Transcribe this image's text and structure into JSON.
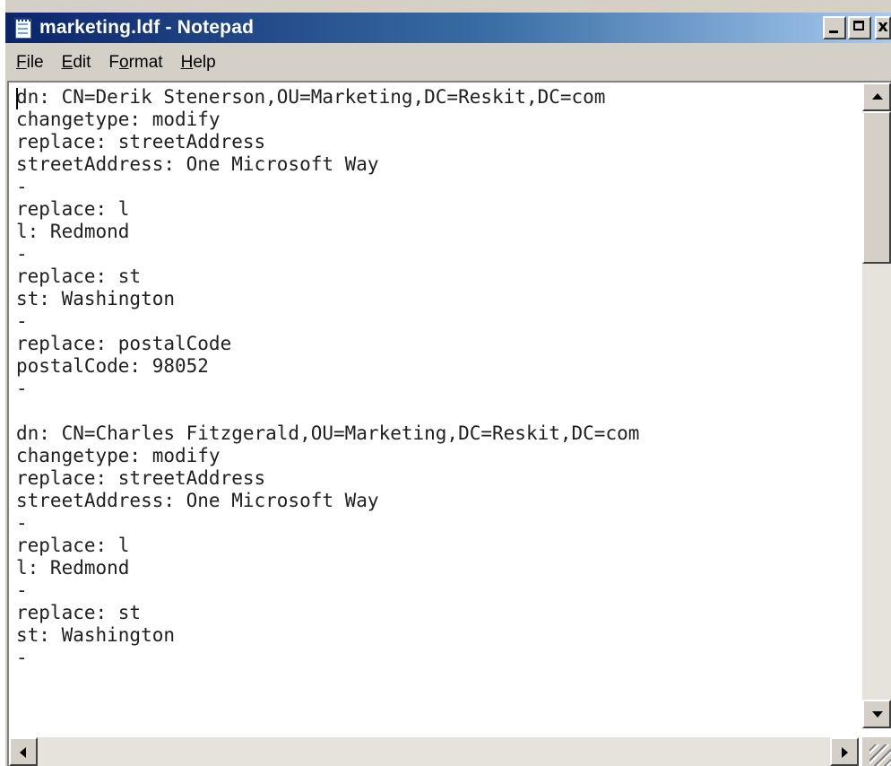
{
  "window": {
    "title": "marketing.ldf - Notepad",
    "icon": "notepad-icon",
    "close_glyph": "x"
  },
  "menu": {
    "items": [
      {
        "label": "File",
        "accel": "F",
        "rest": "ile"
      },
      {
        "label": "Edit",
        "accel": "E",
        "rest": "dit"
      },
      {
        "label": "Format",
        "pre": "F",
        "accel": "o",
        "rest": "rmat"
      },
      {
        "label": "Help",
        "accel": "H",
        "rest": "elp"
      }
    ]
  },
  "document": {
    "lines": [
      "dn: CN=Derik Stenerson,OU=Marketing,DC=Reskit,DC=com",
      "changetype: modify",
      "replace: streetAddress",
      "streetAddress: One Microsoft Way",
      "-",
      "replace: l",
      "l: Redmond",
      "-",
      "replace: st",
      "st: Washington",
      "-",
      "replace: postalCode",
      "postalCode: 98052",
      "-",
      "",
      "dn: CN=Charles Fitzgerald,OU=Marketing,DC=Reskit,DC=com",
      "changetype: modify",
      "replace: streetAddress",
      "streetAddress: One Microsoft Way",
      "-",
      "replace: l",
      "l: Redmond",
      "-",
      "replace: st",
      "st: Washington",
      "-"
    ]
  },
  "colors": {
    "titlebar_start": "#0a246a",
    "titlebar_end": "#a6caf0",
    "chrome": "#d4d0c8",
    "text": "#202020"
  }
}
